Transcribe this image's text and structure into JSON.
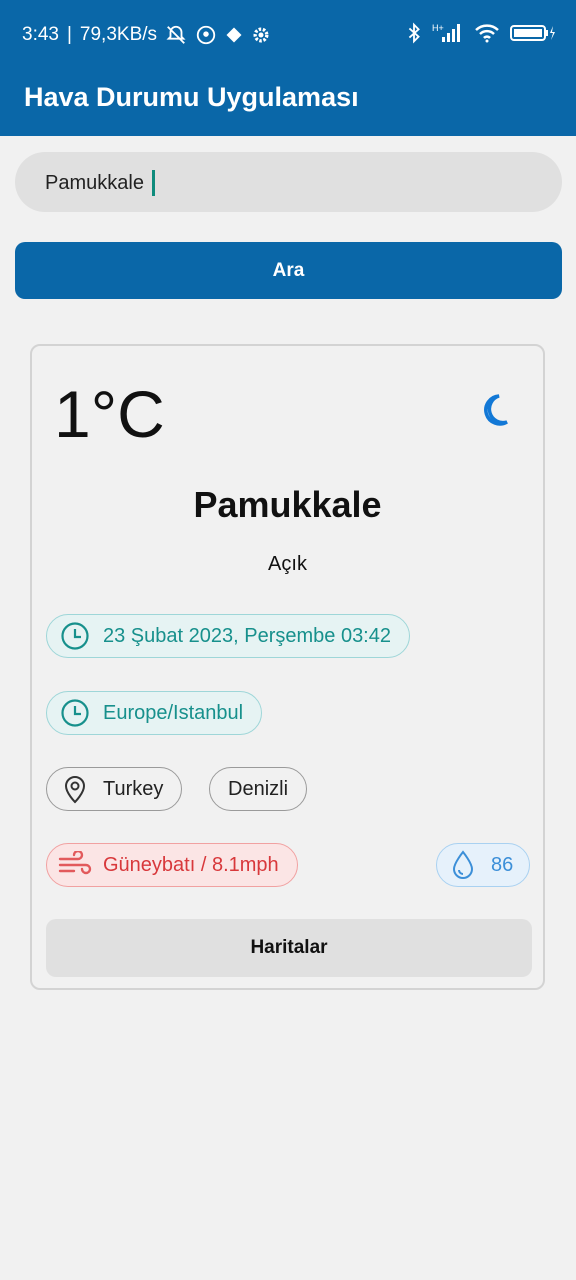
{
  "status_bar": {
    "time": "3:43",
    "speed": "79,3KB/s",
    "icons": [
      "bell-off-icon",
      "location-icon",
      "diamond-icon",
      "settings-icon",
      "bluetooth-icon",
      "signal-icon",
      "wifi-icon",
      "battery-icon"
    ]
  },
  "app_bar": {
    "title": "Hava Durumu Uygulaması",
    "color": "#0a67a8"
  },
  "search": {
    "value": "Pamukkale",
    "placeholder": ""
  },
  "search_button": {
    "label": "Ara"
  },
  "weather": {
    "temperature": "1°C",
    "city": "Pamukkale",
    "condition": "Açık",
    "datetime": "23 Şubat 2023, Perşembe 03:42",
    "timezone": "Europe/Istanbul",
    "country": "Turkey",
    "region": "Denizli",
    "wind": "Güneybatı / 8.1mph",
    "humidity": "86",
    "condition_icon": "moon-icon"
  },
  "maps_button": {
    "label": "Haritalar"
  }
}
